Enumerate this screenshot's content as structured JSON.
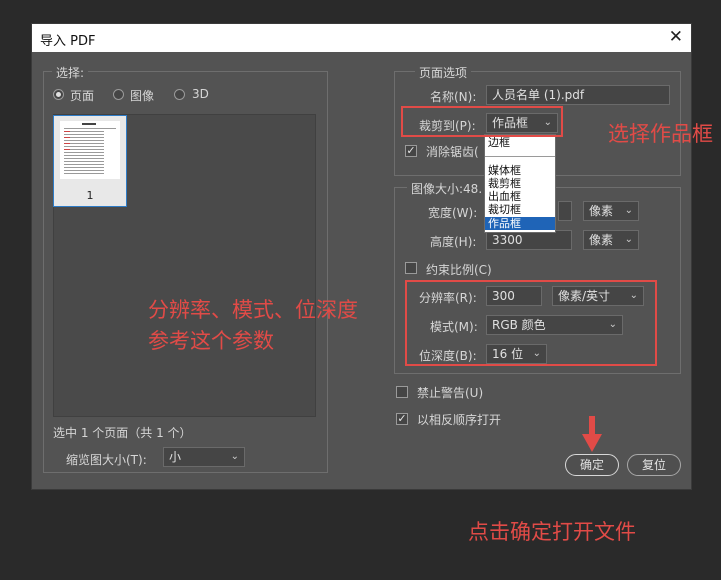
{
  "dialog": {
    "title": "导入 PDF",
    "close_glyph": "✕"
  },
  "select_group": {
    "legend": "选择:",
    "radios": [
      "页面",
      "图像",
      "3D"
    ],
    "thumbnail_number": "1",
    "status": "选中 1 个页面（共 1 个）",
    "thumb_size_label": "缩览图大小(T):",
    "thumb_size_value": "小"
  },
  "page_options": {
    "legend": "页面选项",
    "name_label": "名称(N):",
    "name_value": "人员名单 (1).pdf",
    "crop_label": "裁剪到(P):",
    "crop_value": "作品框",
    "antialias_label": "消除锯齿(",
    "crop_options": [
      "边框",
      "媒体框",
      "裁剪框",
      "出血框",
      "裁切框",
      "作品框"
    ]
  },
  "image_size": {
    "legend": "图像大小:48.",
    "width_label": "宽度(W):",
    "width_unit": "像素",
    "height_label": "高度(H):",
    "height_value": "3300",
    "height_unit": "像素",
    "constrain_label": "约束比例(C)",
    "resolution_label": "分辨率(R):",
    "resolution_value": "300",
    "resolution_unit": "像素/英寸",
    "mode_label": "模式(M):",
    "mode_value": "RGB 颜色",
    "depth_label": "位深度(B):",
    "depth_value": "16 位"
  },
  "options": {
    "suppress_warnings_label": "禁止警告(U)",
    "reverse_order_label": "以相反顺序打开"
  },
  "buttons": {
    "ok": "确定",
    "reset": "复位"
  },
  "annotations": {
    "select_artbox": "选择作品框",
    "params_line1": "分辨率、模式、位深度",
    "params_line2": "参考这个参数",
    "click_ok": "点击确定打开文件"
  },
  "colors": {
    "annotation_red": "#e14b47",
    "dialog_bg": "#535353",
    "selection_blue": "#1f64b7"
  }
}
